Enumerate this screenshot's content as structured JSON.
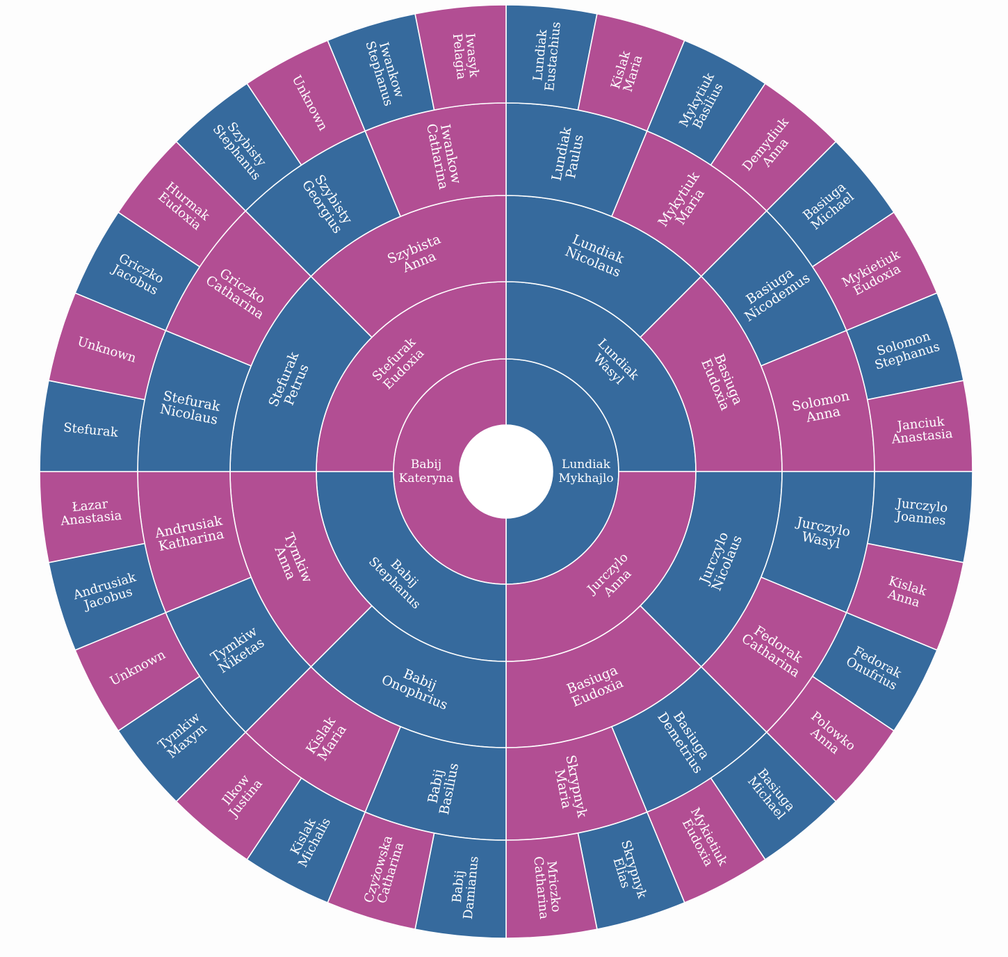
{
  "colors": {
    "male": "#366a9d",
    "female": "#b24e93",
    "stroke": "#ffffff",
    "text": "#ffffff"
  },
  "fan": {
    "root_ring": [
      {
        "slot": 0,
        "sex": "M",
        "surname": "Lundiak",
        "given": "Mykhajlo"
      },
      {
        "slot": 1,
        "sex": "F",
        "surname": "Babij",
        "given": "Kateryna"
      }
    ],
    "generations": [
      [
        {
          "slot": 0,
          "sex": "M",
          "surname": "Lundiak",
          "given": "Wasyl"
        },
        {
          "slot": 1,
          "sex": "F",
          "surname": "Jurczylo",
          "given": "Anna"
        },
        {
          "slot": 2,
          "sex": "M",
          "surname": "Babij",
          "given": "Stephanus"
        },
        {
          "slot": 3,
          "sex": "F",
          "surname": "Stefurak",
          "given": "Eudoxia"
        }
      ],
      [
        {
          "slot": 0,
          "sex": "M",
          "surname": "Lundiak",
          "given": "Nicolaus"
        },
        {
          "slot": 1,
          "sex": "F",
          "surname": "Basiuga",
          "given": "Eudoxia"
        },
        {
          "slot": 2,
          "sex": "M",
          "surname": "Jurczylo",
          "given": "Nicolaus"
        },
        {
          "slot": 3,
          "sex": "F",
          "surname": "Basiuga",
          "given": "Eudoxia"
        },
        {
          "slot": 4,
          "sex": "M",
          "surname": "Babij",
          "given": "Onophrius"
        },
        {
          "slot": 5,
          "sex": "F",
          "surname": "Tymkiw",
          "given": "Anna"
        },
        {
          "slot": 6,
          "sex": "M",
          "surname": "Stefurak",
          "given": "Petrus"
        },
        {
          "slot": 7,
          "sex": "F",
          "surname": "Szybista",
          "given": "Anna"
        }
      ],
      [
        {
          "slot": 0,
          "sex": "M",
          "surname": "Lundiak",
          "given": "Paulus"
        },
        {
          "slot": 1,
          "sex": "F",
          "surname": "Mykytiuk",
          "given": "Maria"
        },
        {
          "slot": 2,
          "sex": "M",
          "surname": "Basiuga",
          "given": "Nicodemus"
        },
        {
          "slot": 3,
          "sex": "F",
          "surname": "Solomon",
          "given": "Anna"
        },
        {
          "slot": 4,
          "sex": "M",
          "surname": "Jurczylo",
          "given": "Wasyl"
        },
        {
          "slot": 5,
          "sex": "F",
          "surname": "Fedorak",
          "given": "Catharina"
        },
        {
          "slot": 6,
          "sex": "M",
          "surname": "Basiuga",
          "given": "Demetrius"
        },
        {
          "slot": 7,
          "sex": "F",
          "surname": "Skrypnyk",
          "given": "Maria"
        },
        {
          "slot": 8,
          "sex": "M",
          "surname": "Babij",
          "given": "Basilius"
        },
        {
          "slot": 9,
          "sex": "F",
          "surname": "Kislak",
          "given": "Maria"
        },
        {
          "slot": 10,
          "sex": "M",
          "surname": "Tymkiw",
          "given": "Niketas"
        },
        {
          "slot": 11,
          "sex": "F",
          "surname": "Andrusiak",
          "given": "Katharina"
        },
        {
          "slot": 12,
          "sex": "M",
          "surname": "Stefurak",
          "given": "Nicolaus"
        },
        {
          "slot": 13,
          "sex": "F",
          "surname": "Griczko",
          "given": "Catharina"
        },
        {
          "slot": 14,
          "sex": "M",
          "surname": "Szybisty",
          "given": "Georgius"
        },
        {
          "slot": 15,
          "sex": "F",
          "surname": "Iwankow",
          "given": "Catharina"
        }
      ],
      [
        {
          "slot": 0,
          "sex": "M",
          "surname": "Lundiak",
          "given": "Eustachius"
        },
        {
          "slot": 1,
          "sex": "F",
          "surname": "Kislak",
          "given": "Maria"
        },
        {
          "slot": 2,
          "sex": "M",
          "surname": "Mykytiuk",
          "given": "Basilius"
        },
        {
          "slot": 3,
          "sex": "F",
          "surname": "Demydiuk",
          "given": "Anna"
        },
        {
          "slot": 4,
          "sex": "M",
          "surname": "Basiuga",
          "given": "Michael"
        },
        {
          "slot": 5,
          "sex": "F",
          "surname": "Mykietiuk",
          "given": "Eudoxia"
        },
        {
          "slot": 6,
          "sex": "M",
          "surname": "Solomon",
          "given": "Stephanus"
        },
        {
          "slot": 7,
          "sex": "F",
          "surname": "Janciuk",
          "given": "Anastasia"
        },
        {
          "slot": 8,
          "sex": "M",
          "surname": "Jurczylo",
          "given": "Joannes"
        },
        {
          "slot": 9,
          "sex": "F",
          "surname": "Kislak",
          "given": "Anna"
        },
        {
          "slot": 10,
          "sex": "M",
          "surname": "Fedorak",
          "given": "Onufrius"
        },
        {
          "slot": 11,
          "sex": "F",
          "surname": "Polowko",
          "given": "Anna"
        },
        {
          "slot": 12,
          "sex": "M",
          "surname": "Basiuga",
          "given": "Michael"
        },
        {
          "slot": 13,
          "sex": "F",
          "surname": "Mykietiuk",
          "given": "Eudoxia"
        },
        {
          "slot": 14,
          "sex": "M",
          "surname": "Skrypnyk",
          "given": "Elias"
        },
        {
          "slot": 15,
          "sex": "F",
          "surname": "Mriczko",
          "given": "Catharina"
        },
        {
          "slot": 16,
          "sex": "M",
          "surname": "Babij",
          "given": "Damianus"
        },
        {
          "slot": 17,
          "sex": "F",
          "surname": "Czyżowska",
          "given": "Catharina"
        },
        {
          "slot": 18,
          "sex": "M",
          "surname": "Kislak",
          "given": "Michalis"
        },
        {
          "slot": 19,
          "sex": "F",
          "surname": "Ilkow",
          "given": "Justina"
        },
        {
          "slot": 20,
          "sex": "M",
          "surname": "Tymkiw",
          "given": "Maxym"
        },
        {
          "slot": 21,
          "sex": "F",
          "surname": "Unknown",
          "given": ""
        },
        {
          "slot": 22,
          "sex": "M",
          "surname": "Andrusiak",
          "given": "Jacobus"
        },
        {
          "slot": 23,
          "sex": "F",
          "surname": "Łazar",
          "given": "Anastasia"
        },
        {
          "slot": 24,
          "sex": "M",
          "surname": "Stefurak",
          "given": ""
        },
        {
          "slot": 25,
          "sex": "F",
          "surname": "Unknown",
          "given": ""
        },
        {
          "slot": 26,
          "sex": "M",
          "surname": "Griczko",
          "given": "Jacobus"
        },
        {
          "slot": 27,
          "sex": "F",
          "surname": "Hurmak",
          "given": "Eudoxia"
        },
        {
          "slot": 28,
          "sex": "M",
          "surname": "Szybisty",
          "given": "Stephanus"
        },
        {
          "slot": 29,
          "sex": "F",
          "surname": "Unknown",
          "given": ""
        },
        {
          "slot": 30,
          "sex": "M",
          "surname": "Iwankow",
          "given": "Stephanus"
        },
        {
          "slot": 31,
          "sex": "F",
          "surname": "Iwasyk",
          "given": "Pelagia"
        }
      ]
    ]
  }
}
